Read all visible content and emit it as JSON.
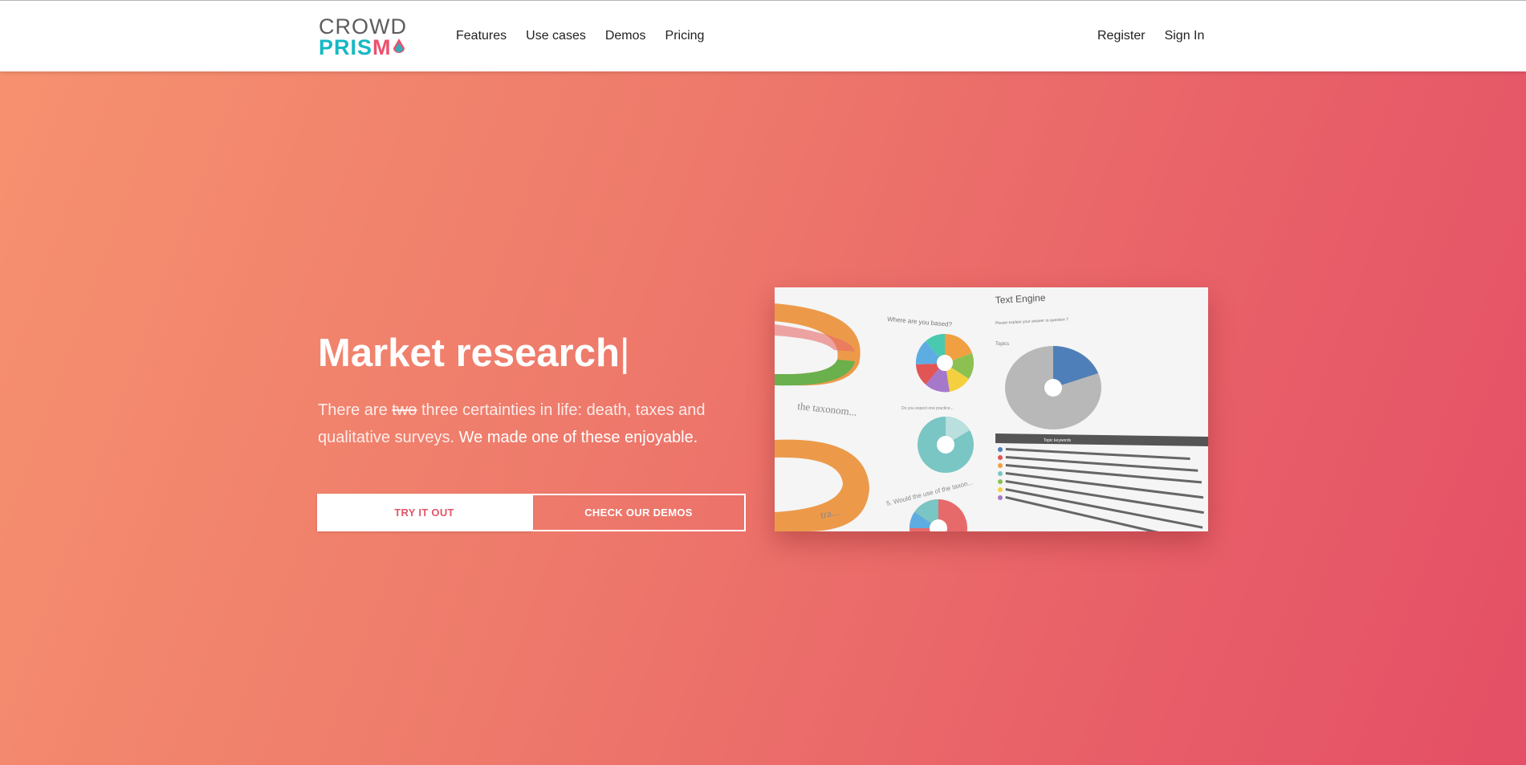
{
  "brand": {
    "line1": "CROWD",
    "line2a": "PRIS",
    "line2b": "M",
    "colors": {
      "grey": "#5d5d5d",
      "teal": "#17b8c4",
      "pink": "#ee4f6e"
    }
  },
  "nav": {
    "links": [
      "Features",
      "Use cases",
      "Demos",
      "Pricing"
    ],
    "right": [
      "Register",
      "Sign In"
    ]
  },
  "hero": {
    "headline": "Market research",
    "cursor": "|",
    "sub_part1": "There are ",
    "sub_strike": "two",
    "sub_part2": " three certainties in life: death, taxes and qualitative surveys.",
    "sub_strong": " We made one of these enjoyable.",
    "btn_try": "TRY IT OUT",
    "btn_demos": "CHECK OUR DEMOS",
    "gradient": [
      "#f6916f",
      "#e44f66"
    ]
  },
  "preview": {
    "title": "Text Engine",
    "subtitle": "Please explain your answer to question 7",
    "q1": "Where are you based?",
    "q2": "Topics",
    "q3": "Do you expect one practice...",
    "q4": "5. Would the use of the taxon...",
    "list_header": "Topic keywords",
    "left_text": "the taxonom...",
    "left_text2": "tra..."
  }
}
